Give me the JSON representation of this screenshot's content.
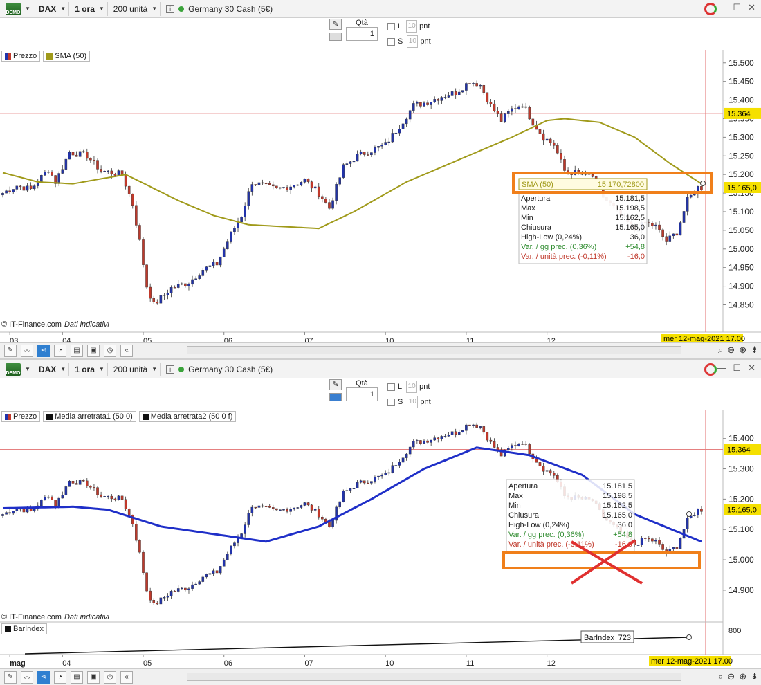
{
  "toolbar": {
    "demo_label": "DEMO",
    "symbol": "DAX",
    "timeframe": "1 ora",
    "bars": "200 unità",
    "instrument": "Germany 30 Cash (5€)"
  },
  "window_controls": [
    "—",
    "☐",
    "✕"
  ],
  "order_panel": {
    "qty_label": "Qtà",
    "qty_value": "1",
    "l_label": "L",
    "s_label": "S",
    "pnt_value": "10",
    "pnt_label": "pnt"
  },
  "top_chart": {
    "legend": [
      {
        "name": "Prezzo",
        "color": "#c0392b"
      },
      {
        "name": "SMA (50)",
        "color": "#a09a1a"
      }
    ],
    "credit_source": "© IT-Finance.com",
    "credit_note": "Dati indicativi",
    "price_tag_cursor": "15.364",
    "price_tag_last": "15.165,0",
    "date_tag": "mer 12-mag-2021 17.00",
    "sma_tooltip": {
      "label": "SMA (50)",
      "value": "15.170,72800"
    },
    "info_rows": [
      {
        "label": "Apertura",
        "value": "15.181,5",
        "color": "#222222"
      },
      {
        "label": "Max",
        "value": "15.198,5",
        "color": "#222222"
      },
      {
        "label": "Min",
        "value": "15.162,5",
        "color": "#222222"
      },
      {
        "label": "Chiusura",
        "value": "15.165,0",
        "color": "#222222"
      },
      {
        "label": "High-Low (0,24%)",
        "value": "36,0",
        "color": "#222222"
      },
      {
        "label": "Var. / gg prec. (0,36%)",
        "value": "+54,8",
        "color": "#2e8b2e"
      },
      {
        "label": "Var. / unità prec. (-0,11%)",
        "value": "-16,0",
        "color": "#c0392b"
      }
    ]
  },
  "bottom_chart": {
    "legend": [
      {
        "name": "Prezzo",
        "color": "#c0392b"
      },
      {
        "name": "Media arretrata1 (50 0)",
        "color": "#111111"
      },
      {
        "name": "Media arretrata2 (50 0 f)",
        "color": "#111111"
      }
    ],
    "credit_source": "© IT-Finance.com",
    "credit_note": "Dati indicativi",
    "price_tag_cursor": "15.364",
    "price_tag_last": "15.165,0",
    "date_tag": "mer 12-mag-2021 17.00",
    "info_rows": [
      {
        "label": "Apertura",
        "value": "15.181,5",
        "color": "#222222"
      },
      {
        "label": "Max",
        "value": "15.198,5",
        "color": "#222222"
      },
      {
        "label": "Min",
        "value": "15.162,5",
        "color": "#222222"
      },
      {
        "label": "Chiusura",
        "value": "15.165,0",
        "color": "#222222"
      },
      {
        "label": "High-Low (0,24%)",
        "value": "36,0",
        "color": "#222222"
      },
      {
        "label": "Var. / gg prec. (0,36%)",
        "value": "+54,8",
        "color": "#2e8b2e"
      },
      {
        "label": "Var. / unità prec. (-0,11%)",
        "value": "-16,0",
        "color": "#c0392b"
      }
    ],
    "barindex_legend": "BarIndex",
    "barindex_label": "BarIndex",
    "barindex_value": "723"
  },
  "chart_data": [
    {
      "type": "candlestick",
      "series_names": [
        "Prezzo",
        "SMA (50)"
      ],
      "x_ticks": [
        "03",
        "04",
        "05",
        "06",
        "07",
        "10",
        "11",
        "12"
      ],
      "y_ticks": [
        "15.500",
        "15.450",
        "15.400",
        "15.350",
        "15.300",
        "15.250",
        "15.200",
        "15.150",
        "15.100",
        "15.050",
        "15.000",
        "14.950",
        "14.900",
        "14.850"
      ],
      "ylim": [
        14810,
        15520
      ],
      "price_keypoints": [
        [
          0,
          15150
        ],
        [
          4,
          15170
        ],
        [
          8,
          15160
        ],
        [
          13,
          15215
        ],
        [
          15,
          15180
        ],
        [
          19,
          15260
        ],
        [
          24,
          15250
        ],
        [
          28,
          15210
        ],
        [
          34,
          15200
        ],
        [
          37,
          15120
        ],
        [
          39,
          15020
        ],
        [
          41,
          14900
        ],
        [
          43,
          14850
        ],
        [
          48,
          14895
        ],
        [
          53,
          14910
        ],
        [
          57,
          14945
        ],
        [
          61,
          14960
        ],
        [
          65,
          15040
        ],
        [
          68,
          15090
        ],
        [
          71,
          15180
        ],
        [
          74,
          15170
        ],
        [
          78,
          15160
        ],
        [
          82,
          15170
        ],
        [
          86,
          15185
        ],
        [
          90,
          15150
        ],
        [
          93,
          15110
        ],
        [
          97,
          15220
        ],
        [
          101,
          15250
        ],
        [
          105,
          15265
        ],
        [
          109,
          15280
        ],
        [
          113,
          15330
        ],
        [
          117,
          15385
        ],
        [
          121,
          15395
        ],
        [
          125,
          15410
        ],
        [
          129,
          15420
        ],
        [
          133,
          15450
        ],
        [
          136,
          15440
        ],
        [
          139,
          15385
        ],
        [
          142,
          15345
        ],
        [
          145,
          15375
        ],
        [
          148,
          15390
        ],
        [
          151,
          15340
        ],
        [
          154,
          15300
        ],
        [
          157,
          15280
        ],
        [
          160,
          15210
        ],
        [
          165,
          15200
        ],
        [
          168,
          15195
        ],
        [
          171,
          15140
        ],
        [
          174,
          15110
        ],
        [
          177,
          15080
        ],
        [
          180,
          15050
        ],
        [
          183,
          15070
        ],
        [
          186,
          15060
        ],
        [
          189,
          15020
        ],
        [
          192,
          15045
        ],
        [
          195,
          15130
        ],
        [
          198,
          15165
        ]
      ],
      "sma_keypoints": [
        [
          0,
          15205
        ],
        [
          10,
          15180
        ],
        [
          20,
          15175
        ],
        [
          35,
          15200
        ],
        [
          50,
          15130
        ],
        [
          60,
          15090
        ],
        [
          70,
          15065
        ],
        [
          80,
          15060
        ],
        [
          90,
          15055
        ],
        [
          100,
          15100
        ],
        [
          115,
          15180
        ],
        [
          130,
          15240
        ],
        [
          145,
          15300
        ],
        [
          155,
          15345
        ],
        [
          160,
          15350
        ],
        [
          170,
          15340
        ],
        [
          180,
          15300
        ],
        [
          190,
          15230
        ],
        [
          199,
          15175
        ]
      ],
      "date_boundaries": [
        0,
        15,
        38,
        61,
        84,
        107,
        130,
        153,
        176,
        199
      ]
    },
    {
      "type": "candlestick",
      "series_names": [
        "Prezzo",
        "Media arretrata1 (50 0)",
        "Media arretrata2 (50 0 f)"
      ],
      "x_ticks": [
        "mag",
        "04",
        "05",
        "06",
        "07",
        "10",
        "11",
        "12"
      ],
      "y_ticks": [
        "15.400",
        "15.300",
        "15.200",
        "15.100",
        "15.000",
        "14.900"
      ],
      "ylim": [
        14820,
        15470
      ],
      "ma_keypoints": [
        [
          0,
          15170
        ],
        [
          20,
          15175
        ],
        [
          30,
          15165
        ],
        [
          45,
          15110
        ],
        [
          60,
          15085
        ],
        [
          75,
          15060
        ],
        [
          90,
          15110
        ],
        [
          105,
          15200
        ],
        [
          120,
          15300
        ],
        [
          135,
          15370
        ],
        [
          150,
          15345
        ],
        [
          165,
          15280
        ],
        [
          180,
          15150
        ],
        [
          199,
          15060
        ]
      ],
      "barindex": {
        "name": "BarIndex",
        "last_value": 723,
        "y_tick": "800"
      }
    }
  ]
}
